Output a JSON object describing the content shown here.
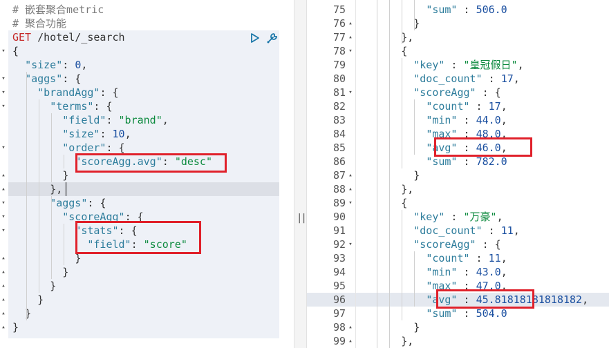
{
  "left": {
    "comment1": "# 嵌套聚合metric",
    "comment2": "# 聚合功能",
    "method": "GET",
    "url": "/hotel/_search",
    "run_icon": "play-icon",
    "settings_icon": "wrench-icon",
    "lines": [
      "{",
      "  \"size\": 0,",
      "  \"aggs\": {",
      "    \"brandAgg\": {",
      "      \"terms\": {",
      "        \"field\": \"brand\",",
      "        \"size\": 10,",
      "        \"order\": {",
      "          \"scoreAgg.avg\": \"desc\"",
      "        }",
      "      },",
      "      \"aggs\": {",
      "        \"scoreAgg\": {",
      "          \"stats\": {",
      "            \"field\": \"score\"",
      "          }",
      "        }",
      "      }",
      "    }",
      "  }",
      "}"
    ]
  },
  "splitter": {
    "label": "||"
  },
  "right": {
    "numbers": [
      "75",
      "76",
      "77",
      "78",
      "79",
      "80",
      "81",
      "82",
      "83",
      "84",
      "85",
      "86",
      "87",
      "88",
      "89",
      "90",
      "91",
      "92",
      "93",
      "94",
      "95",
      "96",
      "97",
      "98",
      "99"
    ],
    "lines": [
      "          \"sum\" : 506.0",
      "        }",
      "      },",
      "      {",
      "        \"key\" : \"皇冠假日\",",
      "        \"doc_count\" : 17,",
      "        \"scoreAgg\" : {",
      "          \"count\" : 17,",
      "          \"min\" : 44.0,",
      "          \"max\" : 48.0,",
      "          \"avg\" : 46.0,",
      "          \"sum\" : 782.0",
      "        }",
      "      },",
      "      {",
      "        \"key\" : \"万豪\",",
      "        \"doc_count\" : 11,",
      "        \"scoreAgg\" : {",
      "          \"count\" : 11,",
      "          \"min\" : 43.0,",
      "          \"max\" : 47.0,",
      "          \"avg\" : 45.81818181818182,",
      "          \"sum\" : 504.0",
      "        }",
      "      },"
    ]
  },
  "colors": {
    "highlight_box": "#e0202a",
    "key": "#2e7d9c",
    "string": "#0c8a3e",
    "number": "#1a4fa0",
    "method": "#c62828"
  }
}
